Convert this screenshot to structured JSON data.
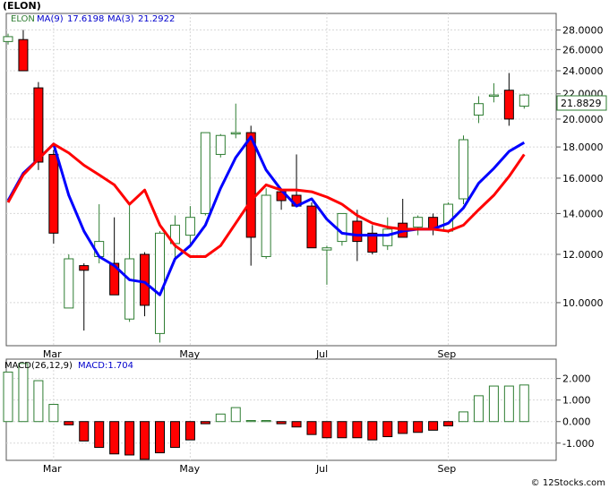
{
  "title": "(ELON)",
  "watermark": "© 12Stocks.com",
  "colors": {
    "up": "#2e7d32",
    "down": "#ff0000",
    "ma_fast": "#ff0000",
    "ma_slow": "#0000ff",
    "last_price_box": "#2e7d32"
  },
  "chart_data": [
    {
      "type": "candlestick",
      "legend": {
        "ticker": "ELON",
        "ma9_label": "MA(9)",
        "ma9_value": "17.6198",
        "ma3_label": "MA(3)",
        "ma3_value": "21.2922"
      },
      "last_price": "21.8829",
      "x_labels": [
        {
          "label": "Mar",
          "index": 3
        },
        {
          "label": "May",
          "index": 12
        },
        {
          "label": "Jul",
          "index": 21
        },
        {
          "label": "Sep",
          "index": 29
        }
      ],
      "y_ticks": [
        "28.0000",
        "26.0000",
        "24.0000",
        "22.0000",
        "20.0000",
        "18.0000",
        "16.0000",
        "14.0000",
        "12.0000",
        "10.0000"
      ],
      "y_scale": "log",
      "ylim": [
        8.5,
        29.8
      ],
      "candles": [
        {
          "o": 26.8,
          "h": 27.6,
          "l": 26.5,
          "c": 27.3
        },
        {
          "o": 27.0,
          "h": 28.0,
          "l": 24.0,
          "c": 24.0
        },
        {
          "o": 22.5,
          "h": 23.0,
          "l": 16.5,
          "c": 17.0
        },
        {
          "o": 17.5,
          "h": 17.8,
          "l": 12.5,
          "c": 13.0
        },
        {
          "o": 9.8,
          "h": 12.0,
          "l": 9.8,
          "c": 11.8
        },
        {
          "o": 11.5,
          "h": 11.6,
          "l": 9.0,
          "c": 11.3
        },
        {
          "o": 11.9,
          "h": 14.5,
          "l": 11.6,
          "c": 12.6
        },
        {
          "o": 11.6,
          "h": 13.8,
          "l": 10.3,
          "c": 10.3
        },
        {
          "o": 9.4,
          "h": 14.5,
          "l": 9.3,
          "c": 11.8
        },
        {
          "o": 12.0,
          "h": 12.1,
          "l": 9.5,
          "c": 9.9
        },
        {
          "o": 8.9,
          "h": 13.1,
          "l": 8.6,
          "c": 13.0
        },
        {
          "o": 12.5,
          "h": 13.9,
          "l": 11.8,
          "c": 13.4
        },
        {
          "o": 12.9,
          "h": 14.4,
          "l": 12.5,
          "c": 13.8
        },
        {
          "o": 14.0,
          "h": 19.0,
          "l": 13.9,
          "c": 19.0
        },
        {
          "o": 17.5,
          "h": 18.9,
          "l": 17.3,
          "c": 18.8
        },
        {
          "o": 19.0,
          "h": 21.2,
          "l": 18.6,
          "c": 19.0
        },
        {
          "o": 19.0,
          "h": 19.5,
          "l": 11.5,
          "c": 12.8
        },
        {
          "o": 11.9,
          "h": 15.4,
          "l": 11.8,
          "c": 15.0
        },
        {
          "o": 15.2,
          "h": 15.4,
          "l": 14.2,
          "c": 14.7
        },
        {
          "o": 15.0,
          "h": 17.5,
          "l": 14.4,
          "c": 14.4
        },
        {
          "o": 14.4,
          "h": 14.6,
          "l": 12.3,
          "c": 12.3
        },
        {
          "o": 12.2,
          "h": 12.4,
          "l": 10.7,
          "c": 12.3
        },
        {
          "o": 12.6,
          "h": 14.0,
          "l": 12.4,
          "c": 14.0
        },
        {
          "o": 13.6,
          "h": 14.2,
          "l": 11.7,
          "c": 12.6
        },
        {
          "o": 13.0,
          "h": 13.4,
          "l": 12.0,
          "c": 12.1
        },
        {
          "o": 12.4,
          "h": 13.8,
          "l": 12.2,
          "c": 13.2
        },
        {
          "o": 13.5,
          "h": 14.8,
          "l": 12.9,
          "c": 12.8
        },
        {
          "o": 13.3,
          "h": 13.9,
          "l": 12.9,
          "c": 13.8
        },
        {
          "o": 13.8,
          "h": 14.0,
          "l": 12.9,
          "c": 13.2
        },
        {
          "o": 13.1,
          "h": 14.6,
          "l": 13.0,
          "c": 14.5
        },
        {
          "o": 14.8,
          "h": 18.8,
          "l": 14.5,
          "c": 18.5
        },
        {
          "o": 20.3,
          "h": 21.8,
          "l": 19.7,
          "c": 21.2
        },
        {
          "o": 21.9,
          "h": 22.9,
          "l": 21.3,
          "c": 21.9
        },
        {
          "o": 22.3,
          "h": 23.8,
          "l": 19.5,
          "c": 20.0
        },
        {
          "o": 21.0,
          "h": 22.0,
          "l": 20.8,
          "c": 21.9
        }
      ],
      "series": [
        {
          "name": "MA(3)",
          "color": "#0000ff",
          "values": [
            14.7,
            16.3,
            17.2,
            18.2,
            15.0,
            13.1,
            11.9,
            11.5,
            10.9,
            10.8,
            10.3,
            11.8,
            12.4,
            13.4,
            15.4,
            17.3,
            18.7,
            16.5,
            15.3,
            14.4,
            14.8,
            13.7,
            13.0,
            12.9,
            12.9,
            12.9,
            13.1,
            13.2,
            13.2,
            13.5,
            14.3,
            15.7,
            16.6,
            17.7,
            18.3
          ]
        },
        {
          "name": "MA(9)",
          "color": "#ff0000",
          "values": [
            14.6,
            16.2,
            17.2,
            18.2,
            17.6,
            16.8,
            16.2,
            15.6,
            14.5,
            15.3,
            13.4,
            12.4,
            11.9,
            11.9,
            12.4,
            13.5,
            14.7,
            15.6,
            15.3,
            15.3,
            15.2,
            14.9,
            14.5,
            13.9,
            13.5,
            13.3,
            13.2,
            13.2,
            13.2,
            13.1,
            13.4,
            14.2,
            15.0,
            16.1,
            17.5
          ]
        }
      ]
    },
    {
      "type": "bar",
      "title": "MACD(26,12,9)",
      "value_label": "MACD:1.704",
      "y_ticks": [
        "2.000",
        "1.000",
        "0.000",
        "-1.000"
      ],
      "ylim": [
        -1.8,
        2.9
      ],
      "x_labels": [
        "Mar",
        "May",
        "Jul",
        "Sep"
      ],
      "values": [
        2.3,
        2.7,
        1.9,
        0.8,
        -0.15,
        -0.9,
        -1.2,
        -1.5,
        -1.55,
        -1.75,
        -1.45,
        -1.2,
        -0.85,
        -0.1,
        0.35,
        0.65,
        0.05,
        0.05,
        -0.1,
        -0.25,
        -0.6,
        -0.75,
        -0.75,
        -0.75,
        -0.85,
        -0.7,
        -0.55,
        -0.5,
        -0.4,
        -0.2,
        0.45,
        1.2,
        1.65,
        1.65,
        1.7
      ]
    }
  ]
}
